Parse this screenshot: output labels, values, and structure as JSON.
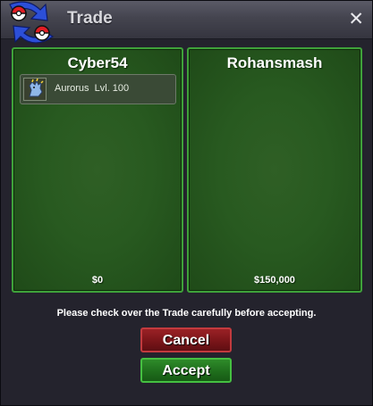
{
  "window": {
    "title": "Trade",
    "close_label": "✕",
    "logo_icon": "trade-arrows-pokeball-icon"
  },
  "left_panel": {
    "player": "Cyber54",
    "items": [
      {
        "label": "Aurorus  Lvl. 100",
        "icon": "aurorus-sprite-icon"
      }
    ],
    "money": "$0"
  },
  "right_panel": {
    "player": "Rohansmash",
    "items": [],
    "money": "$150,000"
  },
  "notice": "Please check over the Trade carefully before accepting.",
  "buttons": {
    "cancel": "Cancel",
    "accept": "Accept"
  },
  "colors": {
    "panel_green": "#285a20",
    "panel_border": "#3fa23a",
    "cancel_red": "#7a1519",
    "accept_green": "#1f6e1c"
  }
}
